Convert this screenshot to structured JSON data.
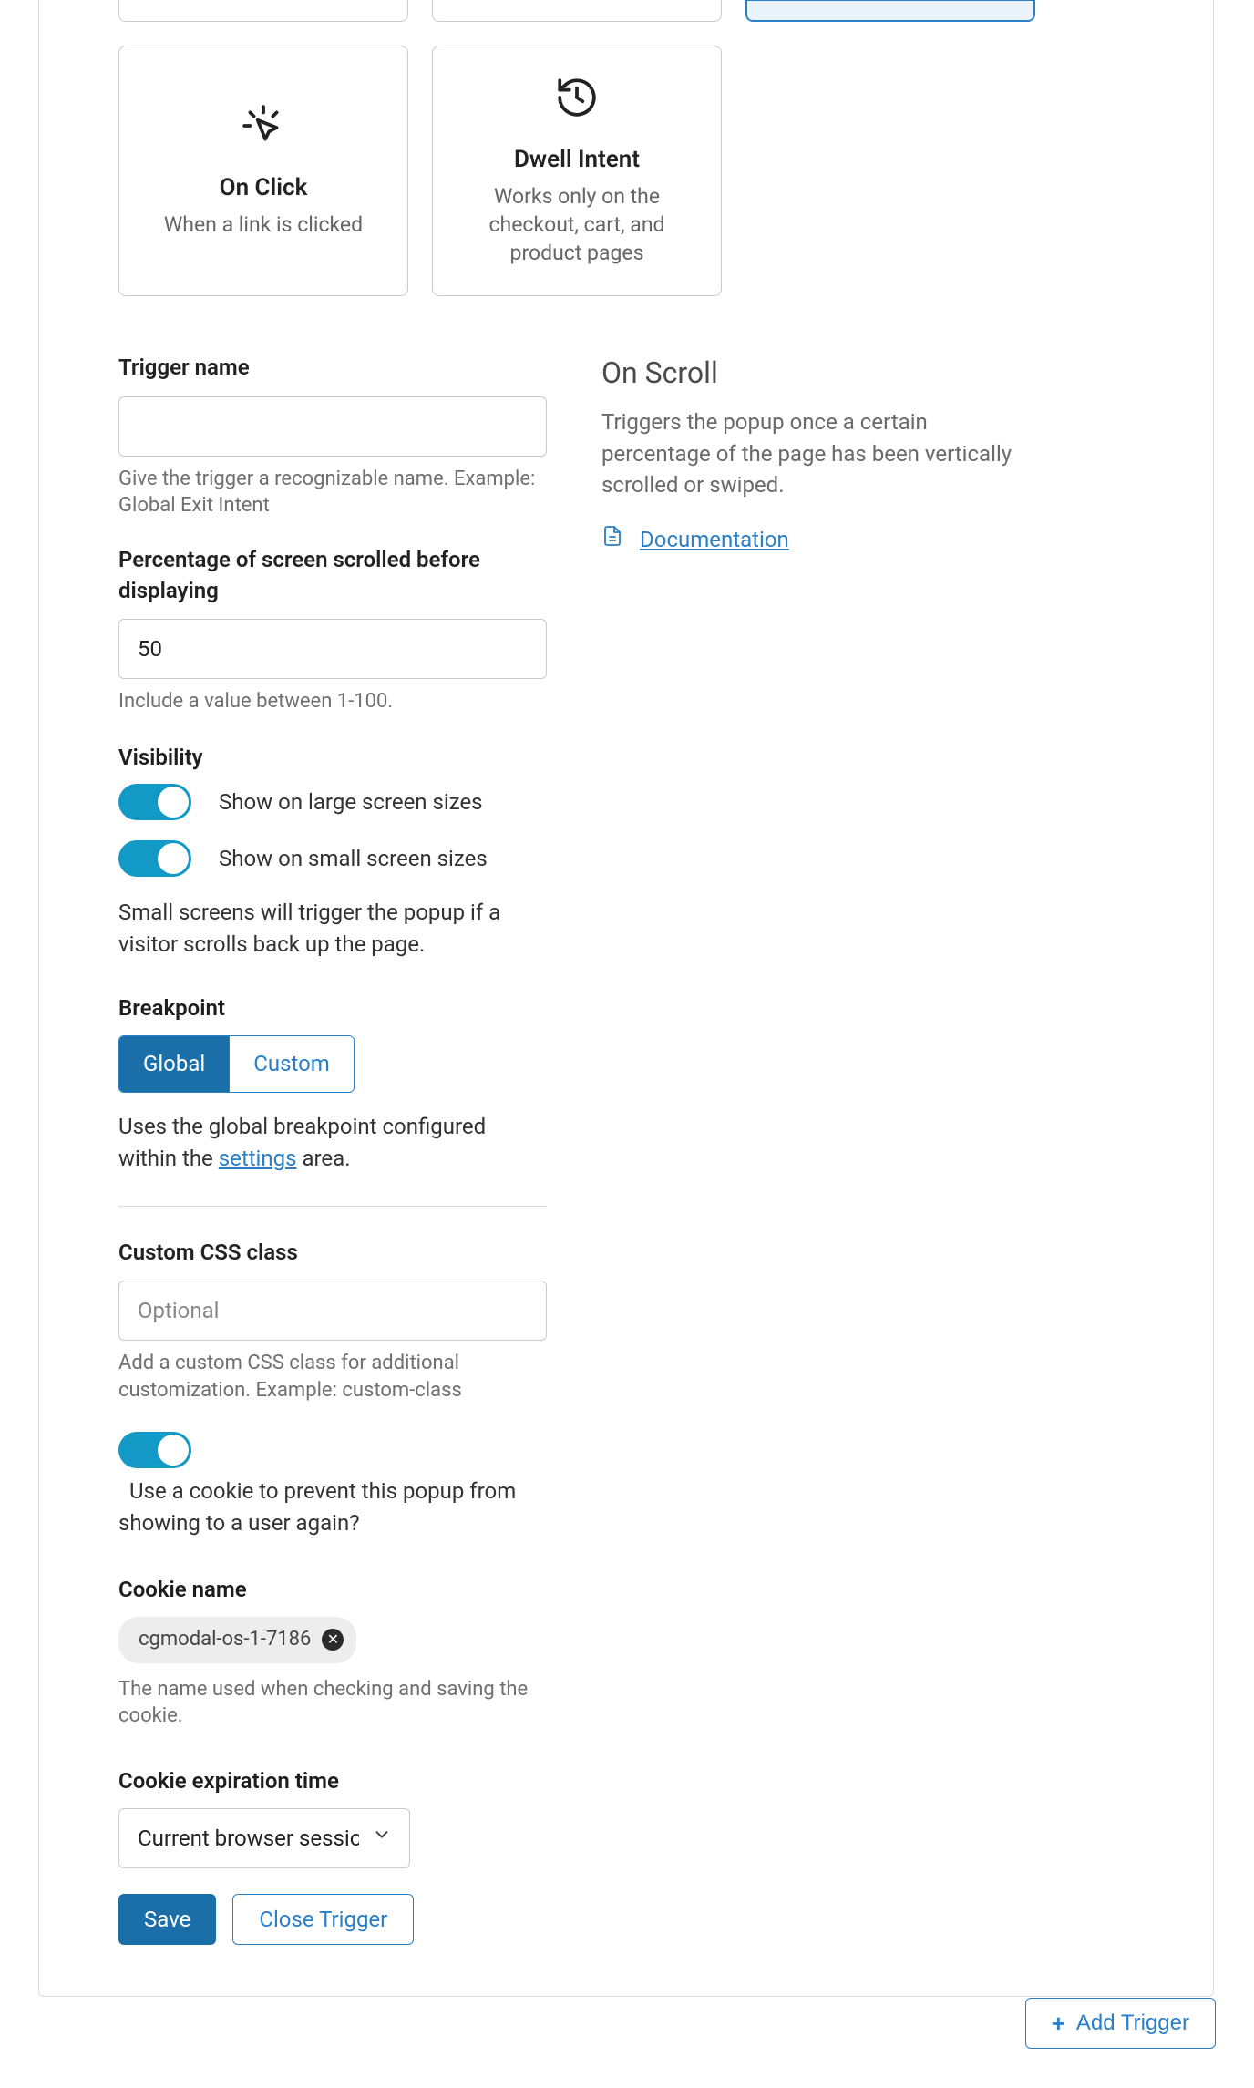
{
  "cards": {
    "on_click": {
      "title": "On Click",
      "desc": "When a link is clicked"
    },
    "dwell": {
      "title": "Dwell Intent",
      "desc": "Works only on the checkout, cart, and product pages"
    }
  },
  "form": {
    "trigger_name_label": "Trigger name",
    "trigger_name_value": "",
    "trigger_name_helper": "Give the trigger a recognizable name. Example: Global Exit Intent",
    "percent_label": "Percentage of screen scrolled before displaying",
    "percent_value": "50",
    "percent_helper": "Include a value between 1-100.",
    "visibility_label": "Visibility",
    "vis_large": "Show on large screen sizes",
    "vis_small": "Show on small screen sizes",
    "vis_note": "Small screens will trigger the popup if a visitor scrolls back up the page.",
    "breakpoint_label": "Breakpoint",
    "bp_global": "Global",
    "bp_custom": "Custom",
    "bp_desc_pre": "Uses the global breakpoint configured within the ",
    "bp_link": "settings",
    "bp_desc_post": " area.",
    "css_label": "Custom CSS class",
    "css_placeholder": "Optional",
    "css_helper": "Add a custom CSS class for additional customization. Example: custom-class",
    "cookie_toggle_label": "Use a cookie to prevent this popup from showing to a user again?",
    "cookie_name_label": "Cookie name",
    "cookie_name_value": "cgmodal-os-1-7186",
    "cookie_name_helper": "The name used when checking and saving the cookie.",
    "cookie_exp_label": "Cookie expiration time",
    "cookie_exp_value": "Current browser session",
    "save": "Save",
    "close": "Close Trigger"
  },
  "info": {
    "title": "On Scroll",
    "desc": "Triggers the popup once a certain percentage of the page has been vertically scrolled or swiped.",
    "doc": "Documentation"
  },
  "footer": {
    "add": "Add Trigger"
  }
}
